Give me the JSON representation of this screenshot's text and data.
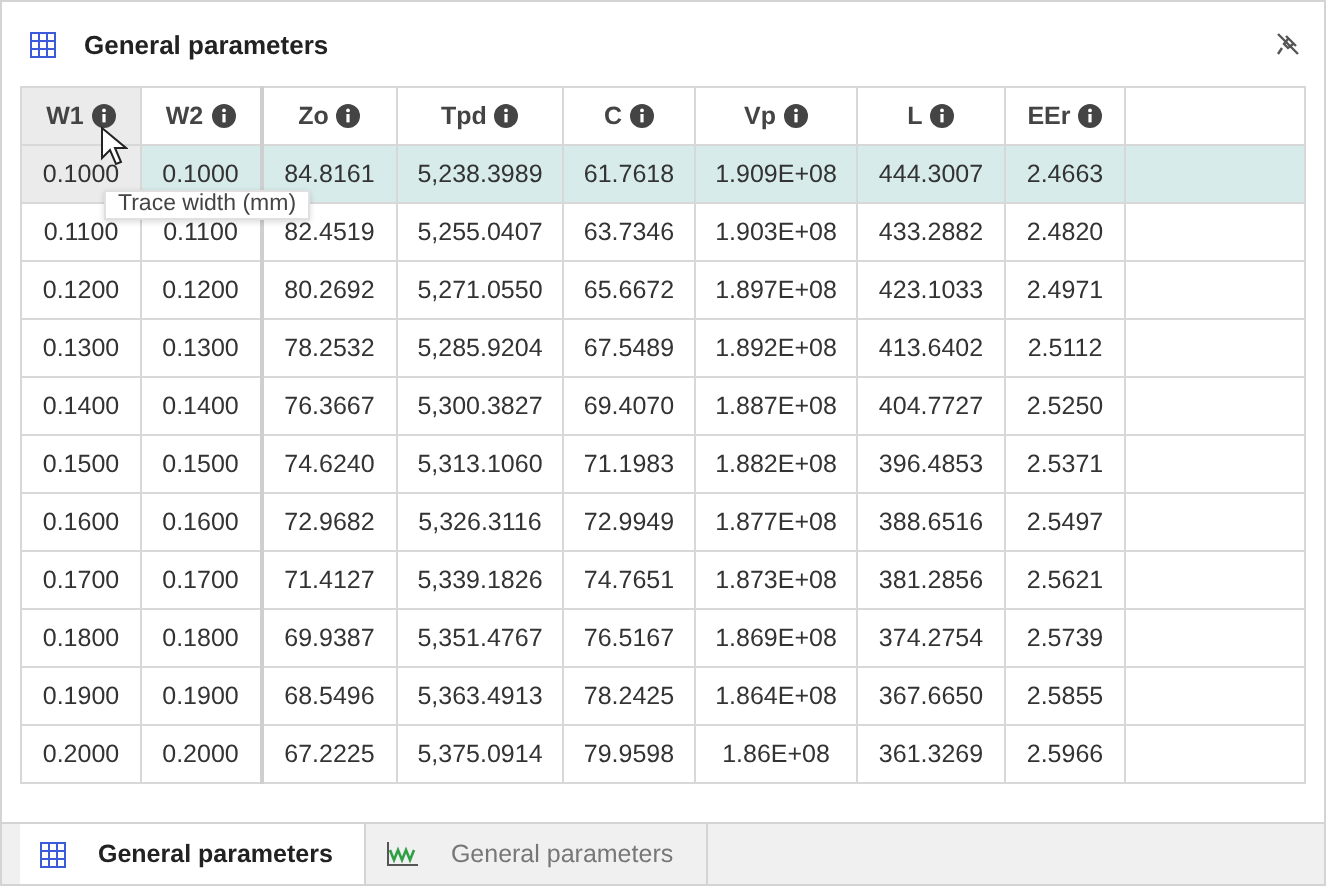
{
  "panel": {
    "title": "General parameters"
  },
  "table": {
    "columns": [
      {
        "label": "W1",
        "highlighted": true
      },
      {
        "label": "W2",
        "highlighted": false
      },
      {
        "label": "Zo",
        "highlighted": false
      },
      {
        "label": "Tpd",
        "highlighted": false
      },
      {
        "label": "C",
        "highlighted": false
      },
      {
        "label": "Vp",
        "highlighted": false
      },
      {
        "label": "L",
        "highlighted": false
      },
      {
        "label": "EEr",
        "highlighted": false
      }
    ],
    "rows": [
      {
        "selected": true,
        "cells": [
          "0.1000",
          "0.1000",
          "84.8161",
          "5,238.3989",
          "61.7618",
          "1.909E+08",
          "444.3007",
          "2.4663"
        ]
      },
      {
        "selected": false,
        "cells": [
          "0.1100",
          "0.1100",
          "82.4519",
          "5,255.0407",
          "63.7346",
          "1.903E+08",
          "433.2882",
          "2.4820"
        ]
      },
      {
        "selected": false,
        "cells": [
          "0.1200",
          "0.1200",
          "80.2692",
          "5,271.0550",
          "65.6672",
          "1.897E+08",
          "423.1033",
          "2.4971"
        ]
      },
      {
        "selected": false,
        "cells": [
          "0.1300",
          "0.1300",
          "78.2532",
          "5,285.9204",
          "67.5489",
          "1.892E+08",
          "413.6402",
          "2.5112"
        ]
      },
      {
        "selected": false,
        "cells": [
          "0.1400",
          "0.1400",
          "76.3667",
          "5,300.3827",
          "69.4070",
          "1.887E+08",
          "404.7727",
          "2.5250"
        ]
      },
      {
        "selected": false,
        "cells": [
          "0.1500",
          "0.1500",
          "74.6240",
          "5,313.1060",
          "71.1983",
          "1.882E+08",
          "396.4853",
          "2.5371"
        ]
      },
      {
        "selected": false,
        "cells": [
          "0.1600",
          "0.1600",
          "72.9682",
          "5,326.3116",
          "72.9949",
          "1.877E+08",
          "388.6516",
          "2.5497"
        ]
      },
      {
        "selected": false,
        "cells": [
          "0.1700",
          "0.1700",
          "71.4127",
          "5,339.1826",
          "74.7651",
          "1.873E+08",
          "381.2856",
          "2.5621"
        ]
      },
      {
        "selected": false,
        "cells": [
          "0.1800",
          "0.1800",
          "69.9387",
          "5,351.4767",
          "76.5167",
          "1.869E+08",
          "374.2754",
          "2.5739"
        ]
      },
      {
        "selected": false,
        "cells": [
          "0.1900",
          "0.1900",
          "68.5496",
          "5,363.4913",
          "78.2425",
          "1.864E+08",
          "367.6650",
          "2.5855"
        ]
      },
      {
        "selected": false,
        "cells": [
          "0.2000",
          "0.2000",
          "67.2225",
          "5,375.0914",
          "79.9598",
          "1.86E+08",
          "361.3269",
          "2.5966"
        ]
      }
    ]
  },
  "tooltip": {
    "text": "Trace width (mm)"
  },
  "tabs": [
    {
      "label": "General parameters",
      "kind": "table",
      "selected": true
    },
    {
      "label": "General parameters",
      "kind": "chart",
      "selected": false
    }
  ]
}
